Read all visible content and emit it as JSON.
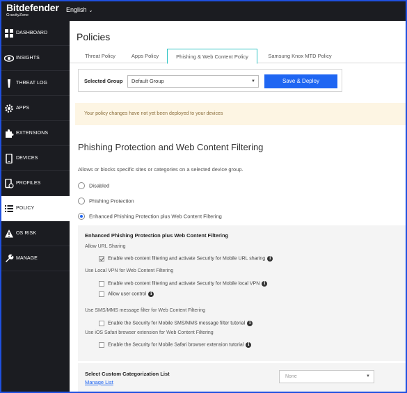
{
  "brand": {
    "name": "Bitdefender",
    "sub": "GravityZone"
  },
  "language": {
    "label": "English"
  },
  "sidebar": {
    "items": [
      {
        "label": "DASHBOARD",
        "icon": "dashboard-icon",
        "active": false
      },
      {
        "label": "INSIGHTS",
        "icon": "eye-icon",
        "active": false
      },
      {
        "label": "THREAT LOG",
        "icon": "threat-log-icon",
        "active": false
      },
      {
        "label": "APPS",
        "icon": "gear-icon",
        "active": false
      },
      {
        "label": "EXTENSIONS",
        "icon": "puzzle-icon",
        "active": false
      },
      {
        "label": "DEVICES",
        "icon": "device-icon",
        "active": false
      },
      {
        "label": "PROFILES",
        "icon": "profile-icon",
        "active": false
      },
      {
        "label": "POLICY",
        "icon": "list-icon",
        "active": true
      },
      {
        "label": "OS RISK",
        "icon": "warning-icon",
        "active": false
      },
      {
        "label": "MANAGE",
        "icon": "wrench-icon",
        "active": false
      }
    ]
  },
  "page": {
    "title": "Policies"
  },
  "tabs": [
    {
      "label": "Threat Policy",
      "active": false
    },
    {
      "label": "Apps Policy",
      "active": false
    },
    {
      "label": "Phishing & Web Content Policy",
      "active": true
    },
    {
      "label": "Samsung Knox MTD Policy",
      "active": false
    }
  ],
  "group": {
    "label": "Selected Group",
    "selected": "Default Group",
    "deploy_label": "Save & Deploy"
  },
  "notice": {
    "text": "Your policy changes have not yet been deployed to your devices"
  },
  "section": {
    "title": "Phishing Protection and Web Content Filtering",
    "description": "Allows or blocks specific sites or categories on a selected device group."
  },
  "radios": [
    {
      "label": "Disabled",
      "checked": false
    },
    {
      "label": "Phishing Protection",
      "checked": false
    },
    {
      "label": "Enhanced Phishing Protection plus Web Content Filtering",
      "checked": true
    }
  ],
  "options": {
    "title": "Enhanced Phishing Protection plus Web Content Filtering",
    "url_sharing": {
      "label": "Allow URL Sharing",
      "checkbox": "Enable web content filtering and activate Security for Mobile URL sharing",
      "checked": true
    },
    "local_vpn": {
      "label": "Use Local VPN for Web Content Filtering",
      "checkbox": "Enable web content filtering and activate Security for Mobile local VPN",
      "checked": false,
      "user_control": "Allow user control",
      "user_control_checked": false
    },
    "sms": {
      "label": "Use SMS/MMS message filter for Web Content Filtering",
      "checkbox": "Enable the Security for Mobile SMS/MMS message filter tutorial",
      "checked": false
    },
    "safari": {
      "label": "Use iOS Safari browser extension for Web Content Filtering",
      "checkbox": "Enable the Security for Mobile Safari browser extension tutorial",
      "checked": false
    }
  },
  "custom": {
    "title": "Select Custom Categorization List",
    "manage_link": "Manage List",
    "selected": "None"
  },
  "colors": {
    "accent": "#1f66f2",
    "sidebar_bg": "#1b1c21",
    "active_tab_border": "#2ec4c4",
    "notice_bg": "#fdf5e3",
    "frame_border": "#1f50e0"
  }
}
